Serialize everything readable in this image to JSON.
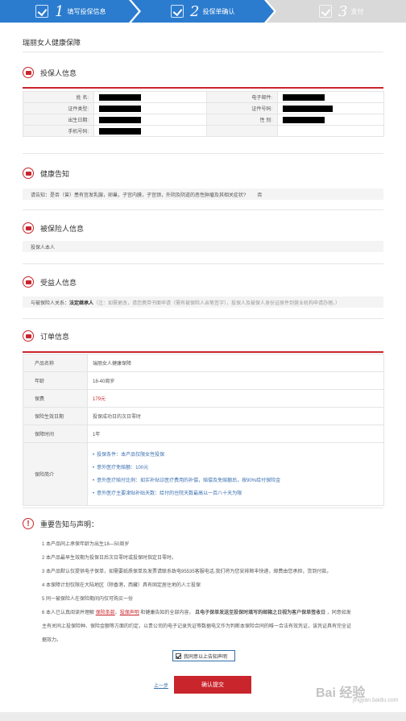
{
  "steps": [
    {
      "num": "1",
      "label": "填写投保信息",
      "color": "#2b7ccf"
    },
    {
      "num": "2",
      "label": "投保单确认",
      "color": "#2b7ccf"
    },
    {
      "num": "3",
      "label": "支付",
      "color": "#d9d9d9"
    }
  ],
  "page_title": "瑞丽女人健康保障",
  "policyholder": {
    "title": "投保人信息",
    "name_label": "姓 名:",
    "email_label": "电子邮件:",
    "id_type_label": "证件类型:",
    "id_no_label": "证件号码:",
    "birth_label": "出生日期:",
    "gender_label": "性 别:",
    "phone_label": "手机号码:"
  },
  "health": {
    "title": "健康告知",
    "question": "请告知：是否（曾）患有宫发乳腺，卵巢，子宫内膜，子宫颈，外阴及阴道的恶性肿瘤及其相关症状?",
    "answer": "否"
  },
  "insured": {
    "title": "被保险人信息",
    "value": "投保人本人"
  },
  "beneficiary": {
    "title": "受益人信息",
    "label": "与被保险人关系：",
    "value": "法定继承人",
    "note": "（注：如需更改，请您携带书面申请（需有被保险人亲笔签字），投保人及被保人身份证原件到营业机构申请办理。）"
  },
  "order": {
    "title": "订单信息",
    "rows": [
      {
        "label": "产品名称",
        "value": "瑞丽女人健康保障"
      },
      {
        "label": "年龄",
        "value": "18-40周岁"
      },
      {
        "label": "保费",
        "value": "179元"
      },
      {
        "label": "保险生效日期",
        "value": "投保成功日的次日零时"
      },
      {
        "label": "保障时间",
        "value": "1年"
      }
    ],
    "intro_label": "保险简介",
    "intro_items": [
      "投保条件：本产品仅限女性投保",
      "意外医疗免赔额：100元",
      "意外医疗赔付比例：如实补贴诊医疗费用的补偿，赔偿及免赔额后，按90%给付保险金",
      "意外医疗主要津贴补贴天数：给付的住院天数最高以一百八十天为限"
    ]
  },
  "notice": {
    "title": "重要告知与声明：",
    "items": [
      "1  本产品同上承保年龄为出生18—50周岁",
      "2  本产品最早生效期为投保日后次日零时或投保时指定日零时。",
      "3  本产品默认仅提供电子保单，如需要纸质保单及发票请联系致电95535客服电话,我们将为您安排顺丰快递，邮费由您承担，货到付款。",
      "4  本保障计划仅限在大陆地区（除香港，西藏）具有固定居住地的人士投保",
      "5  同一被保险人在保险期间内仅可购买一份",
      "6  本人已认真阅读并理解",
      "主有关同上投保险种、保险金额等方面的约定，以贵公司的电子记录凭证等数据电文作为判断本保险合同的唯一合法有效凭证，该凭证具有完全证",
      "据效力。"
    ],
    "link1": "保险条款",
    "link2": "投保声明",
    "item6_mid": "和健康告知的全部内容，",
    "item6_bold": "且电子保单发送至投保时填写的邮箱之日视为客户保单签收日",
    "item6_end": "，同意如发"
  },
  "agree_label": "我同意以上告知声明",
  "prev_label": "上一步",
  "submit_label": "确认提交",
  "watermark": "Bai 经验",
  "watermark_sub": "jingyan.baidu.com",
  "colors": {
    "accent": "#c9252c",
    "step_blue": "#2b7ccf",
    "link": "#3a6fb0"
  }
}
